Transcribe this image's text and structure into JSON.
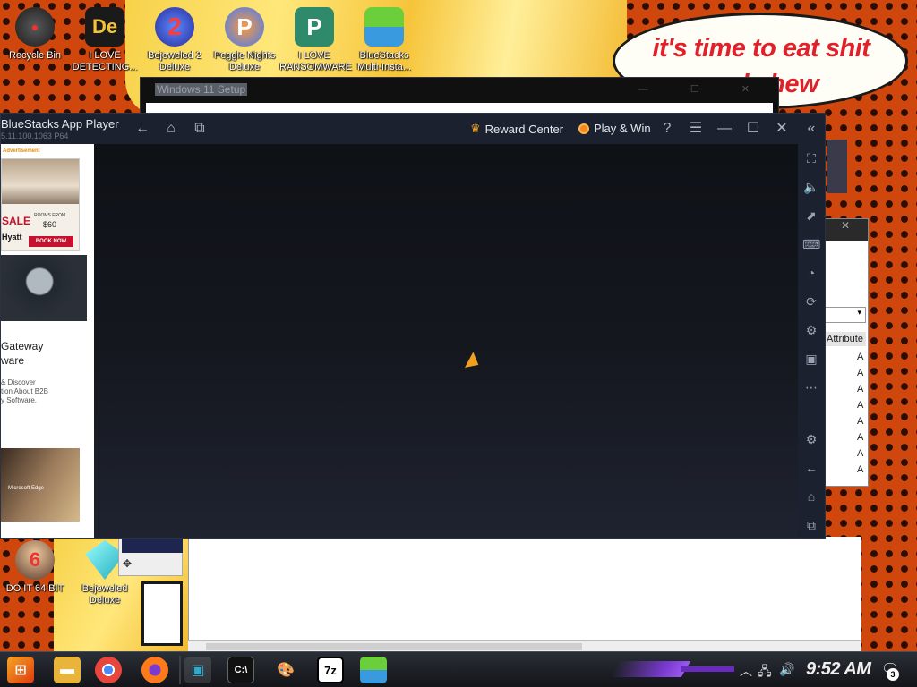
{
  "desktop": {
    "speech_text": "it's time to eat shit and chew",
    "icons": [
      {
        "label": "Recycle Bin"
      },
      {
        "label": "I LOVE DETECTING..."
      },
      {
        "label": "Bejeweled 2 Deluxe"
      },
      {
        "label": "Peggle Nights Deluxe"
      },
      {
        "label": "I LOVE RANSOMWARE"
      },
      {
        "label": "BlueStacks Multi-Insta..."
      },
      {
        "label": "DO IT 64 BIT"
      },
      {
        "label": "Bejeweled Deluxe"
      }
    ]
  },
  "background_windows": {
    "win11_setup_title": "Windows 11 Setup",
    "right_panel_attr": "Attribute",
    "right_panel_rows": [
      "A",
      "A",
      "A",
      "A",
      "A",
      "A",
      "A",
      "A"
    ]
  },
  "bluestacks": {
    "title": "BlueStacks App Player",
    "version": "5.11.100.1063  P64",
    "reward_center": "Reward Center",
    "play_win": "Play & Win",
    "ad": {
      "label": "Advertisement",
      "sale": "SALE",
      "rooms_from": "ROOMS FROM",
      "price": "$60",
      "book_now": "BOOK NOW",
      "brand": "Hyatt",
      "text1": "Gateway\nware",
      "text2": "& Discover\ntion About B2B\ny Software.",
      "video_caption": "Microsoft Edge"
    }
  },
  "taskbar": {
    "clock": "9:52 AM",
    "notification_count": "3",
    "apps": [
      "start",
      "file-explorer",
      "chrome",
      "firefox",
      "windows-setup",
      "command-prompt",
      "paint",
      "7zip",
      "bluestacks"
    ]
  },
  "colors": {
    "wallpaper_orange": "#d0470d",
    "bluestacks_dark": "#1c2130",
    "speech_red": "#e0202a",
    "accent_orange": "#f5a623"
  }
}
